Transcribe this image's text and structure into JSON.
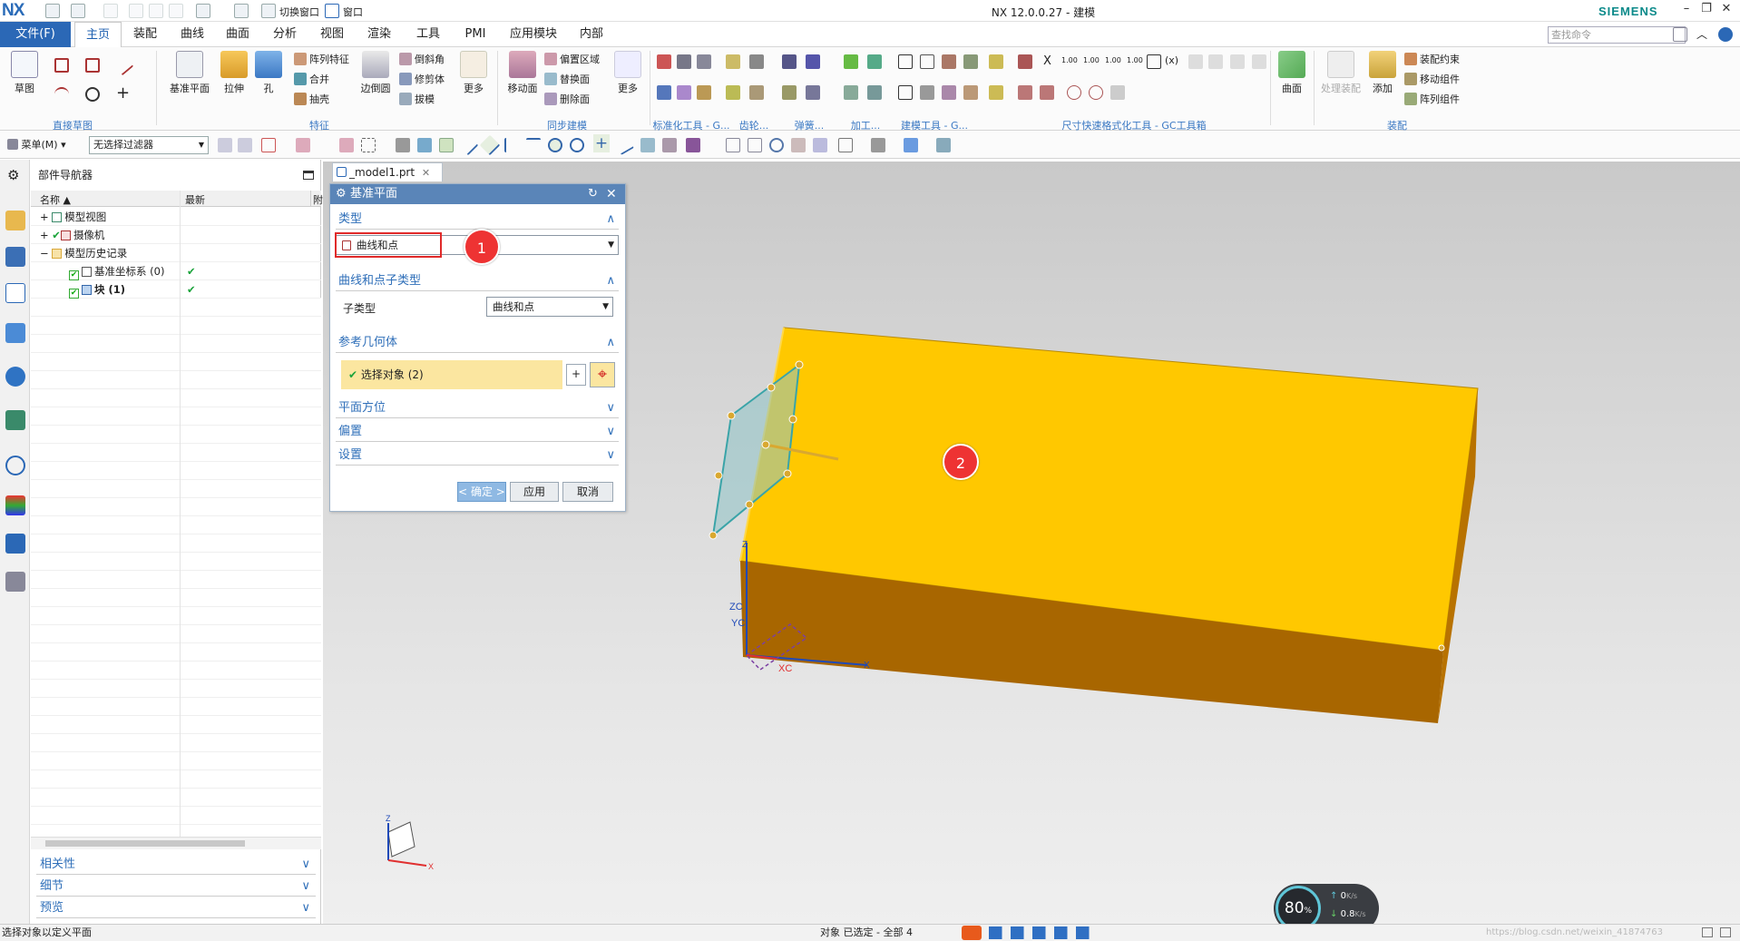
{
  "titlebar": {
    "logo": "NX",
    "switch_window": "切换窗口",
    "window_menu": "窗口",
    "title": "NX 12.0.0.27 - 建模",
    "brand": "SIEMENS",
    "min": "–",
    "restore": "❐",
    "close": "✕"
  },
  "menubar": {
    "file_label": "文件(F)",
    "tabs": [
      "主页",
      "装配",
      "曲线",
      "曲面",
      "分析",
      "视图",
      "渲染",
      "工具",
      "PMI",
      "应用模块",
      "内部"
    ],
    "search_placeholder": "查找命令"
  },
  "ribbon": {
    "sketch": "草图",
    "group_direct_sketch": "直接草图",
    "datum_plane": "基准平面",
    "extrude": "拉伸",
    "hole": "孔",
    "pattern_feature": "阵列特征",
    "unite": "合并",
    "shell": "抽壳",
    "edge_blend": "边倒圆",
    "chamfer": "倒斜角",
    "trim_body": "修剪体",
    "draft": "拔模",
    "more": "更多",
    "group_feature": "特征",
    "move_face": "移动面",
    "offset_region": "偏置区域",
    "replace_face": "替换面",
    "delete_face": "删除面",
    "more2": "更多",
    "group_sync": "同步建模",
    "group_std": "标准化工具 - G...",
    "group_gear": "齿轮...",
    "group_spring": "弹簧...",
    "group_machining": "加工...",
    "group_build": "建模工具 - G...",
    "group_dim": "尺寸快速格式化工具 - GC工具箱",
    "surface": "曲面",
    "process_assembly": "处理装配",
    "add": "添加",
    "assembly_constraint": "装配约束",
    "move_component": "移动组件",
    "pattern_component": "阵列组件",
    "group_assembly": "装配",
    "dim_labels": [
      "1.00",
      "1.00",
      "1.00",
      "1.00"
    ]
  },
  "toolbar2": {
    "menu_label": "菜单(M)",
    "filter": "无选择过滤器"
  },
  "navigator": {
    "title": "部件导航器",
    "col_name": "名称",
    "col_latest": "最新",
    "col_extra": "附",
    "rows": [
      {
        "label": "模型视图",
        "indent": 0
      },
      {
        "label": "摄像机",
        "indent": 0
      },
      {
        "label": "模型历史记录",
        "indent": 0
      },
      {
        "label": "基准坐标系 (0)",
        "indent": 1
      },
      {
        "label": "块 (1)",
        "indent": 1
      }
    ],
    "acc_dependency": "相关性",
    "acc_detail": "细节",
    "acc_preview": "预览"
  },
  "document": {
    "tab": "_model1.prt"
  },
  "dialog": {
    "title": "基准平面",
    "sect_type": "类型",
    "type_value": "曲线和点",
    "sect_subtype": "曲线和点子类型",
    "subtype_label": "子类型",
    "subtype_value": "曲线和点",
    "sect_ref": "参考几何体",
    "select_obj": "选择对象 (2)",
    "sect_orient": "平面方位",
    "sect_offset": "偏置",
    "sect_settings": "设置",
    "ok": "< 确定 >",
    "apply": "应用",
    "cancel": "取消"
  },
  "markers": {
    "m1": "1",
    "m2": "2"
  },
  "axes": {
    "zc": "ZC",
    "yc": "YC",
    "xc": "XC",
    "x": "X",
    "z": "Z",
    "small_z": "Z",
    "small_x": "X"
  },
  "status": {
    "prompt": "选择对象以定义平面",
    "selection": "对象 已选定 - 全部 4",
    "speed_pct": "80",
    "pct_unit": "%",
    "up": "0",
    "down": "0.8",
    "rate_unit": "K/s",
    "watermark": "https://blog.csdn.net/weixin_41874763"
  },
  "colors": {
    "accent": "#2b68b6",
    "box_top": "#ffc800",
    "box_front": "#a86700",
    "marker": "#e33333"
  }
}
